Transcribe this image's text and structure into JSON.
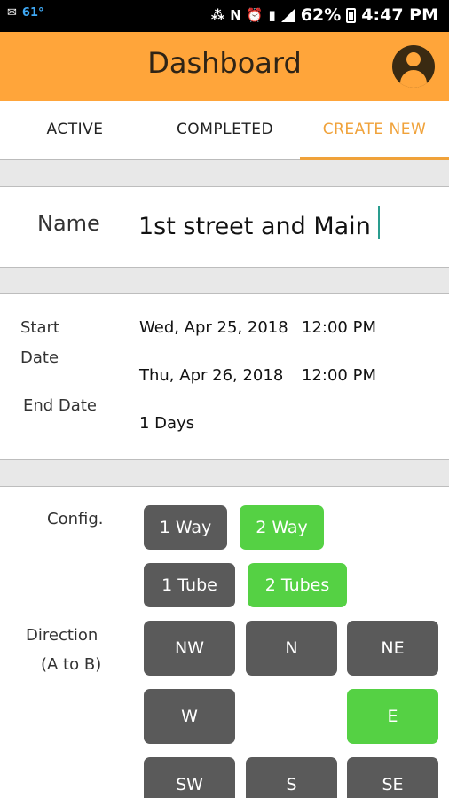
{
  "status_bar": {
    "temperature": "61°",
    "battery": "62%",
    "time": "4:47 PM"
  },
  "app_bar": {
    "title": "Dashboard",
    "profile_icon": "account-circle-icon",
    "background_color": "#ffa53a"
  },
  "tabs": [
    {
      "label": "ACTIVE",
      "selected": false
    },
    {
      "label": "COMPLETED",
      "selected": false
    },
    {
      "label": "CREATE NEW",
      "selected": true
    }
  ],
  "form": {
    "name_label": "Name",
    "name_value": "1st street and Main",
    "start_date_label_line1": "Start",
    "start_date_label_line2": "Date",
    "start_date": "Wed, Apr 25, 2018",
    "start_time": "12:00 PM",
    "end_date_label": "End Date",
    "end_date": "Thu, Apr 26, 2018",
    "end_time": "12:00 PM",
    "duration": "1 Days",
    "config_label": "Config.",
    "config_way_options": [
      {
        "label": "1 Way",
        "selected": false
      },
      {
        "label": "2 Way",
        "selected": true
      }
    ],
    "config_tube_options": [
      {
        "label": "1 Tube",
        "selected": false
      },
      {
        "label": "2 Tubes",
        "selected": true
      }
    ],
    "direction_label_line1": "Direction",
    "direction_label_line2": "(A to B)",
    "directions": {
      "nw": {
        "label": "NW",
        "selected": false
      },
      "n": {
        "label": "N",
        "selected": false
      },
      "ne": {
        "label": "NE",
        "selected": false
      },
      "w": {
        "label": "W",
        "selected": false
      },
      "e": {
        "label": "E",
        "selected": true
      },
      "sw": {
        "label": "SW",
        "selected": false
      },
      "s": {
        "label": "S",
        "selected": false
      },
      "se": {
        "label": "SE",
        "selected": false
      }
    }
  },
  "colors": {
    "accent_orange": "#f0a23a",
    "selected_green": "#55d144",
    "unselected_gray": "#5a5a5a"
  }
}
